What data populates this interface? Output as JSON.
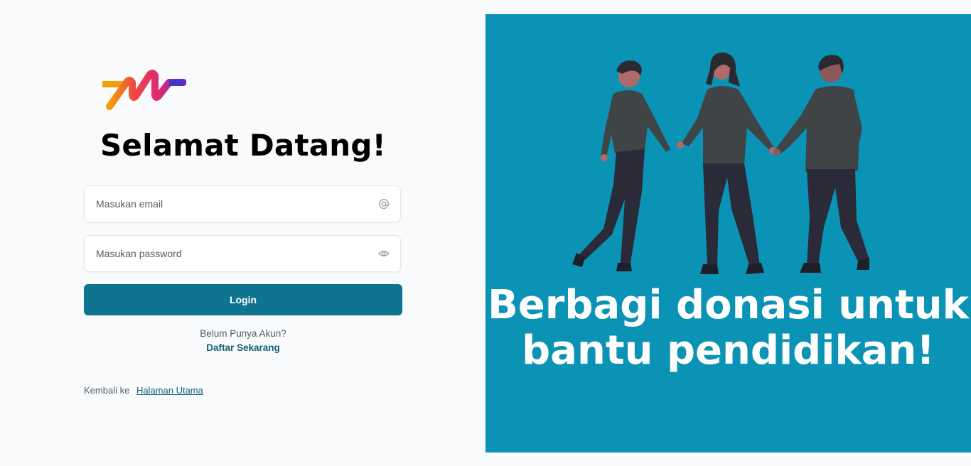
{
  "login": {
    "title": "Selamat Datang!",
    "email_placeholder": "Masukan email",
    "password_placeholder": "Masukan password",
    "email_icon": "at-icon",
    "password_icon": "eye-icon",
    "login_label": "Login",
    "no_account_text": "Belum Punya Akun?",
    "register_label": "Daftar Sekarang",
    "back_text": "Kembali ke",
    "home_link_label": "Halaman Utama"
  },
  "hero": {
    "tagline_line1": "Berbagi donasi untuk",
    "tagline_line2": "bantu pendidikan!",
    "illustration": "three-people-holding-hands"
  },
  "colors": {
    "accent": "#0e7490",
    "link": "#155e75",
    "hero_bg": "#0b93b5",
    "page_bg": "#f8fafc"
  }
}
